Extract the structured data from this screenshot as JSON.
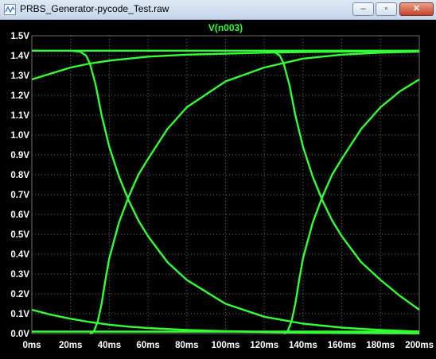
{
  "window": {
    "title": "PRBS_Generator-pycode_Test.raw",
    "icon": "waveform-file-icon",
    "controls": {
      "minimize": "minimize-icon",
      "maximize": "maximize-icon",
      "close": "close-icon"
    }
  },
  "colors": {
    "background": "#000000",
    "trace": "#33ff33",
    "grid": "#6e6e6e",
    "axis_text": "#ffffff",
    "title_text": "#33ff33"
  },
  "chart_data": {
    "type": "line",
    "title": "V(n003)",
    "xlabel": "",
    "ylabel": "",
    "xlim": [
      0,
      200
    ],
    "ylim": [
      0,
      1.5
    ],
    "x_ticks": [
      0,
      20,
      40,
      60,
      80,
      100,
      120,
      140,
      160,
      180,
      200
    ],
    "x_tick_labels": [
      "0ms",
      "20ms",
      "40ms",
      "60ms",
      "80ms",
      "100ms",
      "120ms",
      "140ms",
      "160ms",
      "180ms",
      "200ms"
    ],
    "y_ticks": [
      0,
      0.1,
      0.2,
      0.3,
      0.4,
      0.5,
      0.6,
      0.7,
      0.8,
      0.9,
      1.0,
      1.1,
      1.2,
      1.3,
      1.4,
      1.5
    ],
    "y_tick_labels": [
      "0.0V",
      "0.1V",
      "0.2V",
      "0.3V",
      "0.4V",
      "0.5V",
      "0.6V",
      "0.7V",
      "0.8V",
      "0.9V",
      "1.0V",
      "1.1V",
      "1.2V",
      "1.3V",
      "1.4V",
      "1.5V"
    ],
    "grid": true,
    "series": [
      {
        "x": [
          0,
          200
        ],
        "y": [
          1.425,
          1.425
        ]
      },
      {
        "x": [
          0,
          200
        ],
        "y": [
          0.01,
          0.01
        ]
      },
      {
        "x": [
          0,
          10,
          20,
          30,
          40,
          50,
          60,
          80,
          100,
          120,
          140,
          160,
          180,
          200
        ],
        "y": [
          1.28,
          1.31,
          1.34,
          1.36,
          1.375,
          1.385,
          1.395,
          1.405,
          1.41,
          1.415,
          1.418,
          1.42,
          1.422,
          1.423
        ]
      },
      {
        "x": [
          0,
          10,
          20,
          30,
          40,
          50,
          60,
          80,
          100,
          120,
          140,
          160,
          180,
          200
        ],
        "y": [
          0.12,
          0.095,
          0.075,
          0.058,
          0.045,
          0.035,
          0.028,
          0.018,
          0.012,
          0.008,
          0.005,
          0.003,
          0.002,
          0.001
        ]
      },
      {
        "x": [
          20,
          25,
          28,
          30,
          33,
          36,
          40,
          45,
          50,
          55,
          60,
          70,
          80,
          100,
          120,
          140,
          160,
          180,
          200
        ],
        "y": [
          1.425,
          1.42,
          1.4,
          1.36,
          1.25,
          1.1,
          0.94,
          0.79,
          0.67,
          0.57,
          0.49,
          0.36,
          0.27,
          0.15,
          0.085,
          0.05,
          0.03,
          0.018,
          0.01
        ]
      },
      {
        "x": [
          30,
          32,
          34,
          36,
          38,
          40,
          45,
          50,
          55,
          60,
          70,
          80,
          100,
          120,
          140,
          160,
          180,
          200
        ],
        "y": [
          0.0,
          0.01,
          0.06,
          0.15,
          0.27,
          0.38,
          0.56,
          0.69,
          0.8,
          0.88,
          1.03,
          1.14,
          1.27,
          1.34,
          1.385,
          1.405,
          1.415,
          1.42
        ]
      },
      {
        "x": [
          120,
          125,
          128,
          130,
          133,
          136,
          140,
          145,
          150,
          155,
          160,
          170,
          180,
          190,
          200
        ],
        "y": [
          1.425,
          1.42,
          1.4,
          1.36,
          1.25,
          1.1,
          0.94,
          0.79,
          0.67,
          0.57,
          0.49,
          0.36,
          0.27,
          0.19,
          0.12
        ]
      },
      {
        "x": [
          130,
          132,
          134,
          136,
          138,
          140,
          145,
          150,
          155,
          160,
          170,
          180,
          190,
          200
        ],
        "y": [
          0.0,
          0.01,
          0.06,
          0.15,
          0.27,
          0.38,
          0.56,
          0.69,
          0.8,
          0.88,
          1.03,
          1.14,
          1.22,
          1.28
        ]
      }
    ]
  }
}
